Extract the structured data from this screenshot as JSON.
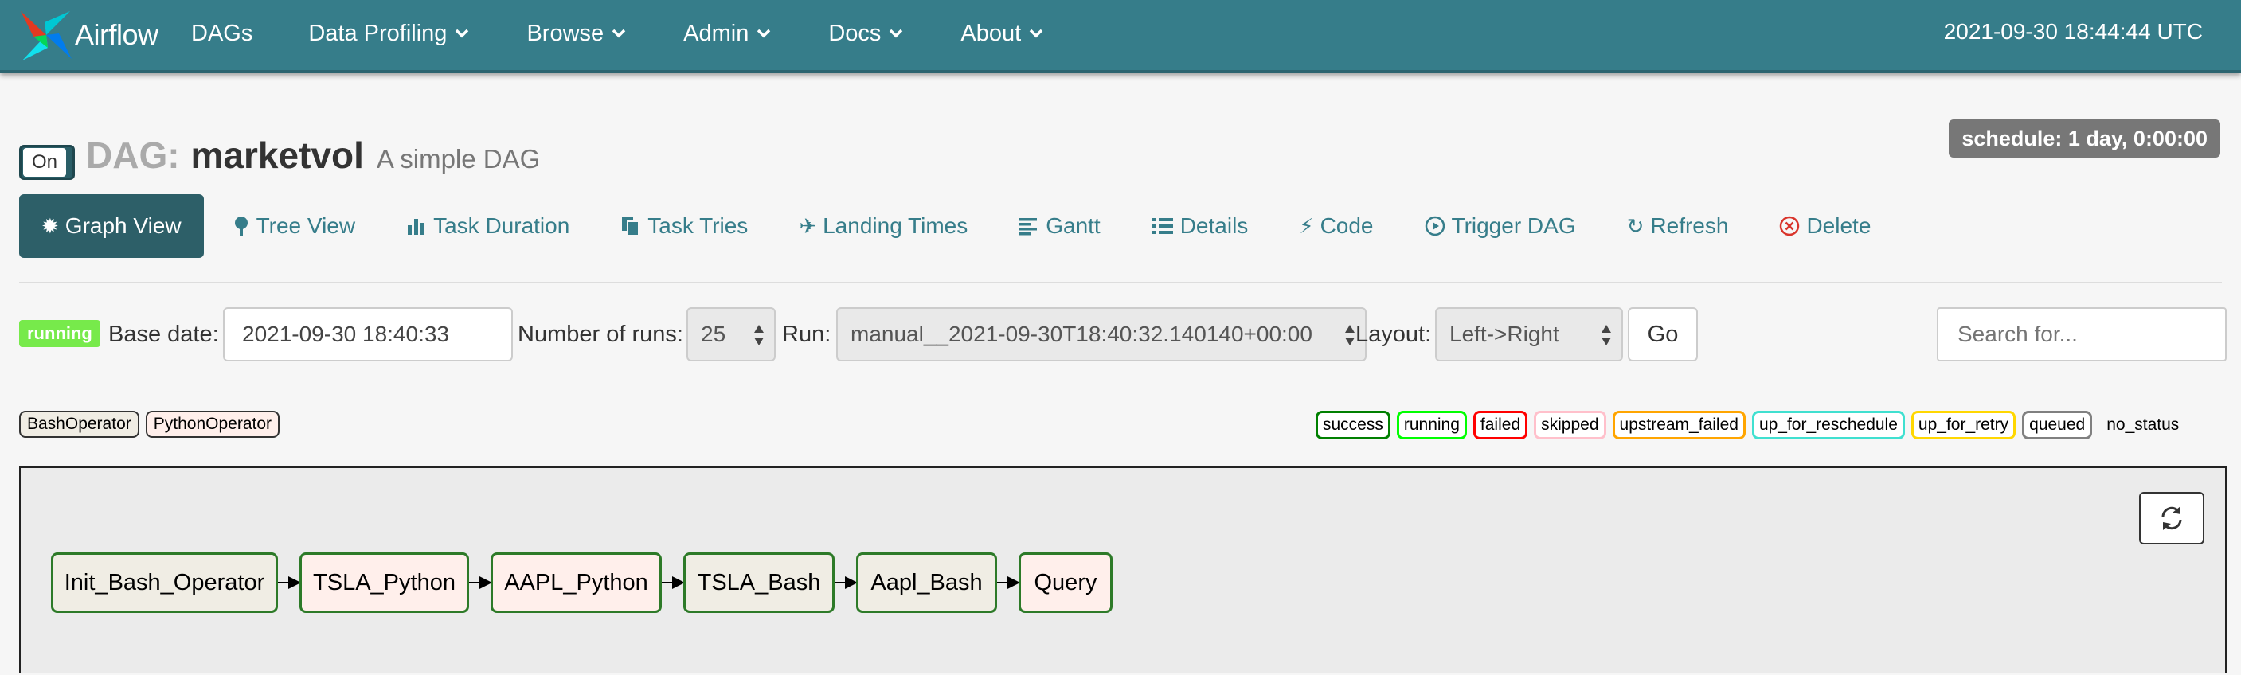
{
  "navbar": {
    "brand": "Airflow",
    "items": [
      {
        "label": "DAGs",
        "dropdown": false
      },
      {
        "label": "Data Profiling",
        "dropdown": true
      },
      {
        "label": "Browse",
        "dropdown": true
      },
      {
        "label": "Admin",
        "dropdown": true
      },
      {
        "label": "Docs",
        "dropdown": true
      },
      {
        "label": "About",
        "dropdown": true
      }
    ],
    "time": "2021-09-30 18:44:44 UTC"
  },
  "header": {
    "toggle_label": "On",
    "dag_prefix": "DAG:",
    "dag_id": "marketvol",
    "description": "A simple DAG",
    "schedule": "schedule: 1 day, 0:00:00"
  },
  "tabs": [
    {
      "label": "Graph View",
      "icon": "asterisk-icon",
      "active": true
    },
    {
      "label": "Tree View",
      "icon": "tree-icon"
    },
    {
      "label": "Task Duration",
      "icon": "bar-chart-icon"
    },
    {
      "label": "Task Tries",
      "icon": "duplicate-icon"
    },
    {
      "label": "Landing Times",
      "icon": "plane-icon"
    },
    {
      "label": "Gantt",
      "icon": "align-left-icon"
    },
    {
      "label": "Details",
      "icon": "list-icon"
    },
    {
      "label": "Code",
      "icon": "flash-icon"
    },
    {
      "label": "Trigger DAG",
      "icon": "play-circle-icon"
    },
    {
      "label": "Refresh",
      "icon": "refresh-icon"
    },
    {
      "label": "Delete",
      "icon": "remove-circle-icon"
    }
  ],
  "controls": {
    "state_badge": "running",
    "base_date_label": "Base date:",
    "base_date_value": "2021-09-30 18:40:33",
    "num_runs_label": "Number of runs:",
    "num_runs_value": "25",
    "run_label": "Run:",
    "run_value": "manual__2021-09-30T18:40:32.140140+00:00",
    "layout_label": "Layout:",
    "layout_value": "Left->Right",
    "go_label": "Go",
    "search_placeholder": "Search for..."
  },
  "operator_legend": [
    {
      "label": "BashOperator",
      "color": "#f0ede4"
    },
    {
      "label": "PythonOperator",
      "color": "#ffefeb"
    }
  ],
  "state_legend": [
    {
      "label": "success",
      "color": "#008000"
    },
    {
      "label": "running",
      "color": "#00ff00"
    },
    {
      "label": "failed",
      "color": "#ff0000"
    },
    {
      "label": "skipped",
      "color": "#ffc0cb"
    },
    {
      "label": "upstream_failed",
      "color": "#ffa500"
    },
    {
      "label": "up_for_reschedule",
      "color": "#40e0d0"
    },
    {
      "label": "up_for_retry",
      "color": "#ffd700"
    },
    {
      "label": "queued",
      "color": "#808080"
    },
    {
      "label": "no_status",
      "color": ""
    }
  ],
  "graph": {
    "nodes": [
      {
        "label": "Init_Bash_Operator",
        "operator": "BashOperator",
        "state": "success"
      },
      {
        "label": "TSLA_Python",
        "operator": "PythonOperator",
        "state": "success"
      },
      {
        "label": "AAPL_Python",
        "operator": "PythonOperator",
        "state": "success"
      },
      {
        "label": "TSLA_Bash",
        "operator": "BashOperator",
        "state": "success"
      },
      {
        "label": "Aapl_Bash",
        "operator": "BashOperator",
        "state": "success"
      },
      {
        "label": "Query",
        "operator": "PythonOperator",
        "state": "success"
      }
    ]
  },
  "colors": {
    "navbar": "#367d8a",
    "accent": "#367d8a",
    "active_tab": "#2d5f68",
    "running": "#77ea4b",
    "node_border_success": "#2d7a28"
  }
}
